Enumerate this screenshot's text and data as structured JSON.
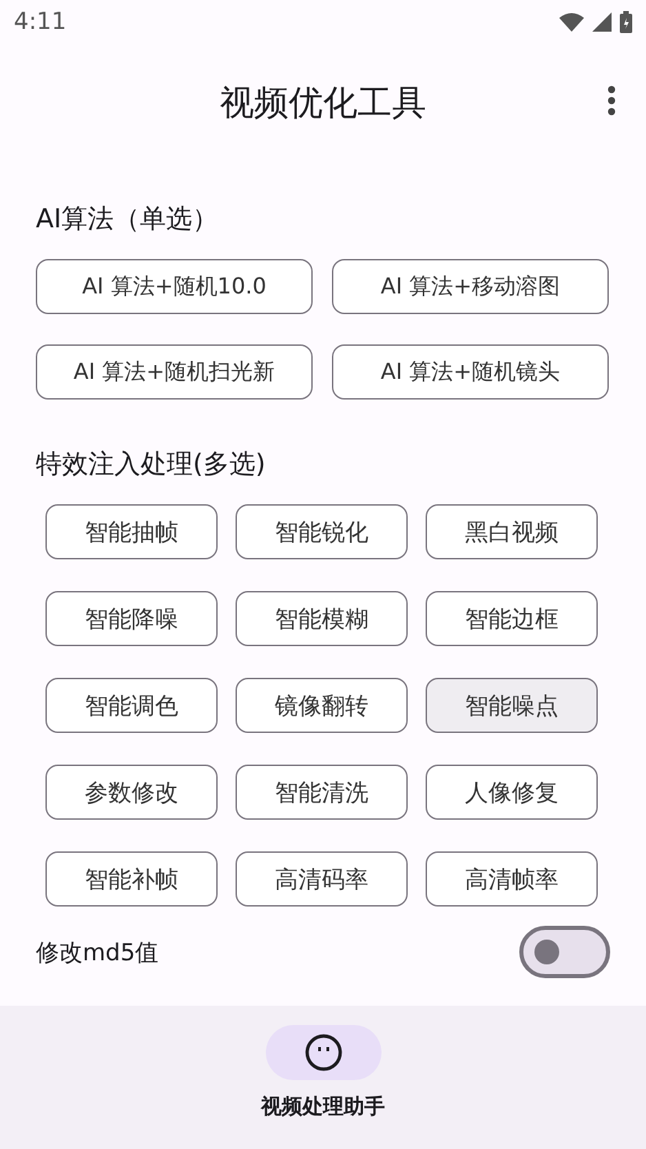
{
  "status_bar": {
    "time": "4:11"
  },
  "app_bar": {
    "title": "视频优化工具"
  },
  "algorithm_section": {
    "title": "AI算法（单选）",
    "options": [
      {
        "label": "AI 算法+随机10.0",
        "selected": false
      },
      {
        "label": "AI 算法+移动溶图",
        "selected": false
      },
      {
        "label": "AI 算法+随机扫光新",
        "selected": false
      },
      {
        "label": "AI 算法+随机镜头",
        "selected": false
      }
    ]
  },
  "effects_section": {
    "title": "特效注入处理(多选)",
    "options": [
      {
        "label": "智能抽帧",
        "selected": false
      },
      {
        "label": "智能锐化",
        "selected": false
      },
      {
        "label": "黑白视频",
        "selected": false
      },
      {
        "label": "智能降噪",
        "selected": false
      },
      {
        "label": "智能模糊",
        "selected": false
      },
      {
        "label": "智能边框",
        "selected": false
      },
      {
        "label": "智能调色",
        "selected": false
      },
      {
        "label": "镜像翻转",
        "selected": false
      },
      {
        "label": "智能噪点",
        "selected": true
      },
      {
        "label": "参数修改",
        "selected": false
      },
      {
        "label": "智能清洗",
        "selected": false
      },
      {
        "label": "人像修复",
        "selected": false
      },
      {
        "label": "智能补帧",
        "selected": false
      },
      {
        "label": "高清码率",
        "selected": false
      },
      {
        "label": "高清帧率",
        "selected": false
      }
    ]
  },
  "md5_switch": {
    "label": "修改md5值",
    "on": false
  },
  "bottom_nav": [
    {
      "label": "视频处理助手",
      "selected": true
    }
  ]
}
